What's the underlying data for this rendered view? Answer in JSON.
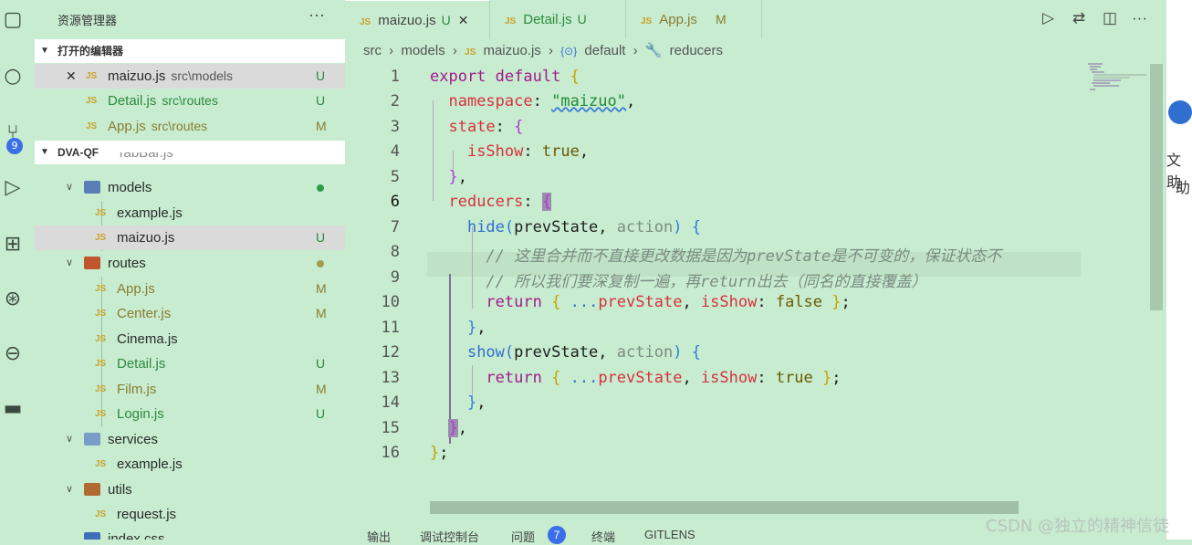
{
  "sidebar": {
    "title": "资源管理器",
    "more": "···",
    "open_editors_title": "打开的编辑器",
    "open_editors": [
      {
        "name": "maizuo.js",
        "path": "src\\models",
        "status": "U",
        "close": "✕"
      },
      {
        "name": "Detail.js",
        "path": "src\\routes",
        "status": "U"
      },
      {
        "name": "App.js",
        "path": "src\\routes",
        "status": "M"
      }
    ],
    "project_title": "DVA-QF",
    "tree": {
      "partial": "TabBar.js",
      "models": "models",
      "models_files": [
        "example.js",
        "maizuo.js"
      ],
      "maizuo_status": "U",
      "routes": "routes",
      "routes_files": [
        {
          "name": "App.js",
          "status": "M"
        },
        {
          "name": "Center.js",
          "status": "M"
        },
        {
          "name": "Cinema.js",
          "status": ""
        },
        {
          "name": "Detail.js",
          "status": "U"
        },
        {
          "name": "Film.js",
          "status": "M"
        },
        {
          "name": "Login.js",
          "status": "U"
        }
      ],
      "services": "services",
      "services_files": [
        "example.js"
      ],
      "utils": "utils",
      "utils_files": [
        "request.js"
      ],
      "partial_bottom": "index.css"
    },
    "js_badge": "JS"
  },
  "activity": {
    "badge": "9",
    "icons": [
      "explorer-icon",
      "search-icon",
      "source-control-icon",
      "run-debug-icon",
      "extensions-icon",
      "git-graph-icon",
      "remote-icon",
      "docker-icon"
    ]
  },
  "tabs": [
    {
      "label": "maizuo.js",
      "status": "U",
      "close": "✕"
    },
    {
      "label": "Detail.js",
      "status": "U"
    },
    {
      "label": "App.js",
      "status": "M"
    }
  ],
  "breadcrumb": {
    "src": "src",
    "sep": "›",
    "models": "models",
    "file": "maizuo.js",
    "default": "default",
    "reducers": "reducers",
    "default_icon": "{⊙}"
  },
  "code": {
    "line_numbers": [
      "1",
      "2",
      "3",
      "4",
      "5",
      "6",
      "7",
      "8",
      "9",
      "10",
      "11",
      "12",
      "13",
      "14",
      "15",
      "16"
    ],
    "current_line": 6,
    "tokens": {
      "export": "export",
      "default": "default",
      "namespace": "namespace",
      "maizuo_str": "\"maizuo\"",
      "state": "state",
      "isShow": "isShow",
      "true": "true",
      "false": "false",
      "reducers": "reducers",
      "hide": "hide",
      "show": "show",
      "prevState": "prevState",
      "action": "action",
      "return": "return",
      "spread": "...",
      "comment1": "// 这里合并而不直接更改数据是因为prevState是不可变的，保证状态不",
      "comment2": "// 所以我们要深复制一遍，再return出去（同名的直接覆盖）"
    }
  },
  "panel": {
    "tabs": [
      "输出",
      "调试控制台",
      "问题",
      "终端",
      "GITLENS"
    ],
    "problems_badge": "7"
  },
  "right_panel": {
    "texts": [
      "文助",
      "助"
    ]
  },
  "watermark": "CSDN @独立的精神信徒",
  "colors": {
    "background": "#c7ecd0",
    "keyword": "#a21a8c",
    "property": "#d8313e",
    "string": "#238a38",
    "function": "#2f6fd0",
    "accent_badge": "#3b6fe8"
  }
}
